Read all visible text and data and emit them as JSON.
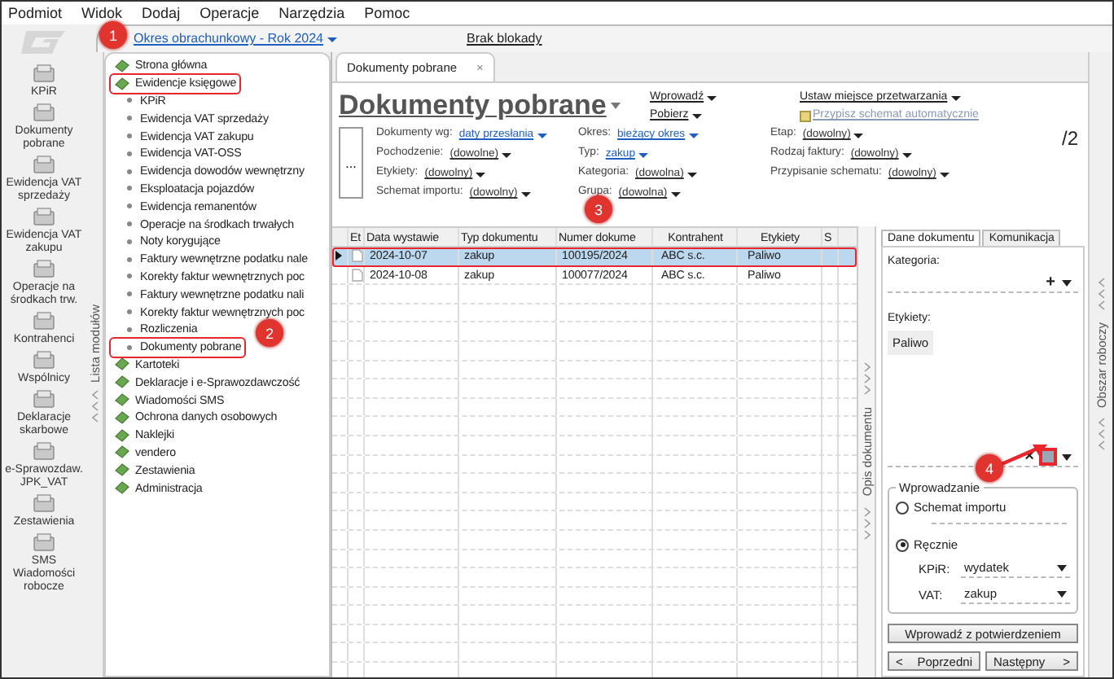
{
  "menu": [
    "Podmiot",
    "Widok",
    "Dodaj",
    "Operacje",
    "Narzędzia",
    "Pomoc"
  ],
  "top_bar": {
    "period": "Okres obrachunkowy - Rok 2024",
    "lock": "Brak blokady"
  },
  "modules": [
    {
      "label": "KPiR"
    },
    {
      "label": "Dokumenty pobrane"
    },
    {
      "label": "Ewidencja VAT sprzedaży"
    },
    {
      "label": "Ewidencja VAT zakupu"
    },
    {
      "label": "Operacje na środkach trw."
    },
    {
      "label": "Kontrahenci"
    },
    {
      "label": "Wspólnicy"
    },
    {
      "label": "Deklaracje skarbowe"
    },
    {
      "label": "e-Sprawozdaw. JPK_VAT"
    },
    {
      "label": "Zestawienia"
    },
    {
      "label": "SMS Wiadomości robocze"
    }
  ],
  "module_list_label": "Lista modułów",
  "tree": [
    {
      "label": "Strona główna",
      "highlighted": false
    },
    {
      "label": "Ewidencje księgowe",
      "highlighted": true,
      "children": [
        {
          "label": "KPiR",
          "highlighted": false
        },
        {
          "label": "Ewidencja VAT sprzedaży",
          "highlighted": false
        },
        {
          "label": "Ewidencja VAT zakupu",
          "highlighted": false
        },
        {
          "label": "Ewidencja VAT-OSS",
          "highlighted": false
        },
        {
          "label": "Ewidencja dowodów wewnętrzny",
          "highlighted": false
        },
        {
          "label": "Eksploatacja pojazdów",
          "highlighted": false
        },
        {
          "label": "Ewidencja remanentów",
          "highlighted": false
        },
        {
          "label": "Operacje na środkach trwałych",
          "highlighted": false
        },
        {
          "label": "Noty korygujące",
          "highlighted": false
        },
        {
          "label": "Faktury wewnętrzne podatku nale",
          "highlighted": false
        },
        {
          "label": "Korekty faktur wewnętrznych poc",
          "highlighted": false
        },
        {
          "label": "Faktury wewnętrzne podatku nali",
          "highlighted": false
        },
        {
          "label": "Korekty faktur wewnętrznych poc",
          "highlighted": false
        },
        {
          "label": "Rozliczenia",
          "highlighted": false
        },
        {
          "label": "Dokumenty pobrane",
          "highlighted": true
        }
      ]
    },
    {
      "label": "Kartoteki",
      "highlighted": false
    },
    {
      "label": "Deklaracje i e-Sprawozdawczość",
      "highlighted": false
    },
    {
      "label": "Wiadomości SMS",
      "highlighted": false
    },
    {
      "label": "Ochrona danych osobowych",
      "highlighted": false
    },
    {
      "label": "Naklejki",
      "highlighted": false
    },
    {
      "label": "vendero",
      "highlighted": false
    },
    {
      "label": "Zestawienia",
      "highlighted": false
    },
    {
      "label": "Administracja",
      "highlighted": false
    }
  ],
  "doc_tab": {
    "label": "Dokumenty pobrane",
    "close": "×"
  },
  "title": "Dokumenty pobrane",
  "actions": [
    "Wprowadź",
    "Pobierz"
  ],
  "place_link": "Ustaw miejsce przetwarzania",
  "schema_link": "Przypisz schemat automatycznie",
  "more_button": "...",
  "filters": [
    [
      {
        "label": "Dokumenty wg:",
        "value": "daty przesłania"
      },
      {
        "label": "Pochodzenie:",
        "value": "(dowolne)"
      },
      {
        "label": "Etykiety:",
        "value": "(dowolny)"
      },
      {
        "label": "Schemat importu:",
        "value": "(dowolny)"
      }
    ],
    [
      {
        "label": "Okres:",
        "value": "bieżący okres"
      },
      {
        "label": "Typ:",
        "value": "zakup"
      },
      {
        "label": "Kategoria:",
        "value": "(dowolna)"
      },
      {
        "label": "Grupa:",
        "value": "(dowolna)"
      }
    ],
    [
      {
        "label": "Etap:",
        "value": "(dowolny)"
      },
      {
        "label": "Rodzaj faktury:",
        "value": "(dowolny)"
      },
      {
        "label": "Przypisanie schematu:",
        "value": "(dowolny)"
      }
    ]
  ],
  "count": "/2",
  "table": {
    "columns": [
      "",
      "Et",
      "Data wystawie",
      "Typ dokumentu",
      "Numer dokume",
      "Kontrahent",
      "Etykiety",
      "S"
    ],
    "rows": [
      {
        "selected": true,
        "highlighted": true,
        "cells": [
          "",
          "",
          "2024-10-07",
          "zakup",
          "100195/2024",
          "ABC s.c.",
          "Paliwo",
          ""
        ]
      },
      {
        "selected": false,
        "highlighted": false,
        "cells": [
          "",
          "",
          "2024-10-08",
          "zakup",
          "100077/2024",
          "ABC s.c.",
          "Paliwo",
          ""
        ]
      }
    ]
  },
  "doc_description_label": "Opis dokumentu",
  "work_area_label": "Obszar roboczy",
  "panel": {
    "tabs": [
      {
        "label": "Dane dokumentu",
        "selected": true
      },
      {
        "label": "Komunikacja",
        "selected": false
      }
    ],
    "category_label": "Kategoria:",
    "add": "+",
    "labels_label": "Etykiety:",
    "tag": "Paliwo",
    "remove": "×",
    "group_title": "Wprowadzanie",
    "options": [
      {
        "label": "Schemat importu",
        "selected": false
      },
      {
        "label": "Ręcznie",
        "selected": true
      }
    ],
    "selects": [
      {
        "label": "KPiR:",
        "value": "wydatek"
      },
      {
        "label": "VAT:",
        "value": "zakup"
      }
    ],
    "confirm_button": "Wprowadź z potwierdzeniem",
    "prev": {
      "arrow": "<",
      "label": "Poprzedni"
    },
    "next": {
      "arrow": ">",
      "label": "Następny"
    }
  },
  "annotations": [
    {
      "label": "1"
    },
    {
      "label": "2"
    },
    {
      "label": "3"
    },
    {
      "label": "4"
    }
  ]
}
